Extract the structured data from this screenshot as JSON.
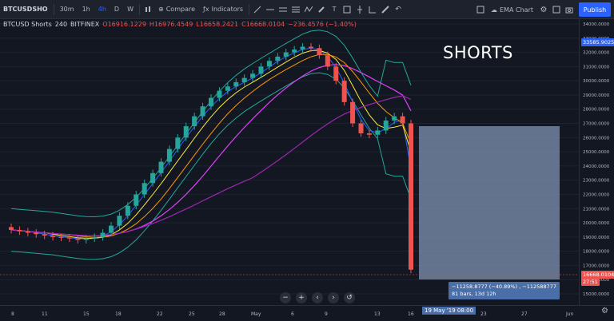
{
  "toolbar": {
    "symbol": "BTCUSDSHO",
    "intervals": [
      "30m",
      "1h",
      "4h",
      "D",
      "W"
    ],
    "active_interval": "4h",
    "compare_label": "Compare",
    "indicators_label": "Indicators",
    "template_label": "EMA Chart",
    "publish_label": "Publish"
  },
  "legend": {
    "title": "BTCUSD Shorts",
    "interval": "240",
    "exchange": "BITFINEX",
    "open": "O16916.1229",
    "high": "H16976.4549",
    "low": "L16658.2421",
    "close": "C16668.0104",
    "change": "−236.4576 (−1.40%)"
  },
  "annotation": {
    "shorts": "SHORTS",
    "measure_line1": "−11258.8777 (−40.89%) , −112588777",
    "measure_line2": "81 bars, 13d 12h",
    "date_marker": "19 May '19  08:00"
  },
  "price_axis": {
    "labels": [
      "34000.0000",
      "33000.0000",
      "32000.0000",
      "31000.0000",
      "30000.0000",
      "29000.0000",
      "28000.0000",
      "27000.0000",
      "26000.0000",
      "25000.0000",
      "24000.0000",
      "23000.0000",
      "22000.0000",
      "21000.0000",
      "20000.0000",
      "19000.0000",
      "18000.0000",
      "17000.0000",
      "16000.0000",
      "15000.0000"
    ],
    "top_tag": "33585.9025",
    "last_price_tag": "16668.0104",
    "countdown_tag": "27:51"
  },
  "time_axis": {
    "labels": [
      "8",
      "11",
      "15",
      "18",
      "22",
      "25",
      "28",
      "May",
      "6",
      "9",
      "13",
      "16",
      "23",
      "27",
      "Jun"
    ]
  },
  "colors": {
    "bg": "#131722",
    "up": "#26a69a",
    "down": "#ef5350",
    "accent": "#2962ff"
  },
  "chart_data": {
    "type": "candlestick",
    "title": "BTCUSD Shorts",
    "ylim": [
      15000,
      34000
    ],
    "ylabel": "",
    "xlabel": "",
    "close": [
      19500,
      19400,
      19300,
      19200,
      19100,
      19000,
      18950,
      18900,
      18800,
      18900,
      19000,
      19300,
      19800,
      20500,
      21200,
      22000,
      22800,
      23500,
      24300,
      25200,
      26000,
      26800,
      27500,
      28200,
      28800,
      29300,
      29600,
      29900,
      30200,
      30500,
      31000,
      31400,
      31700,
      32000,
      32200,
      32400,
      32300,
      31800,
      31000,
      30000,
      28500,
      27000,
      26300,
      26200,
      26500,
      27200,
      27500,
      27000,
      16700
    ],
    "indicators": [
      "Bollinger Bands",
      "EMA",
      "SMA"
    ]
  }
}
